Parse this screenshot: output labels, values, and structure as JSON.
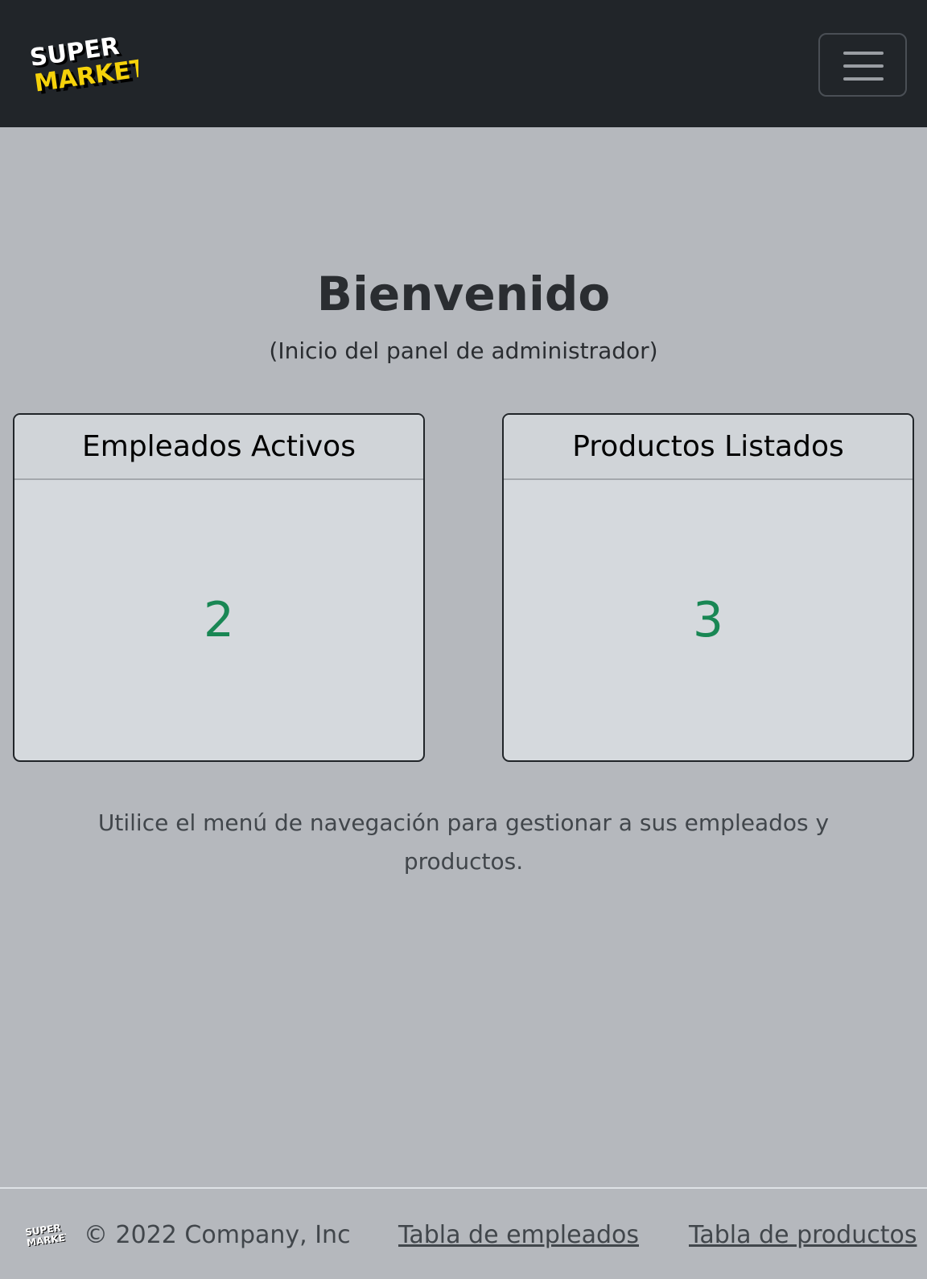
{
  "navbar": {
    "logo": {
      "line1": "SUPER",
      "line2": "MARKET",
      "icon": "supermarket-logo",
      "colors": {
        "white": "#ffffff",
        "yellow": "#f5d20a",
        "shadow": "#000000"
      }
    },
    "toggler_icon": "hamburger-menu-icon"
  },
  "main": {
    "title": "Bienvenido",
    "subtitle": "(Inicio del panel de administrador)",
    "cards": [
      {
        "header": "Empleados Activos",
        "value": "2"
      },
      {
        "header": "Productos Listados",
        "value": "3"
      }
    ],
    "hint": "Utilice el menú de navegación para gestionar a sus empleados y productos."
  },
  "footer": {
    "copyright": "© 2022 Company, Inc",
    "links": [
      {
        "label": "Tabla de empleados"
      },
      {
        "label": "Tabla de productos"
      }
    ]
  },
  "colors": {
    "navbar_bg": "#212529",
    "page_bg": "#b5b8bd",
    "card_bg": "#d5d9dd",
    "value_green": "#198754"
  }
}
